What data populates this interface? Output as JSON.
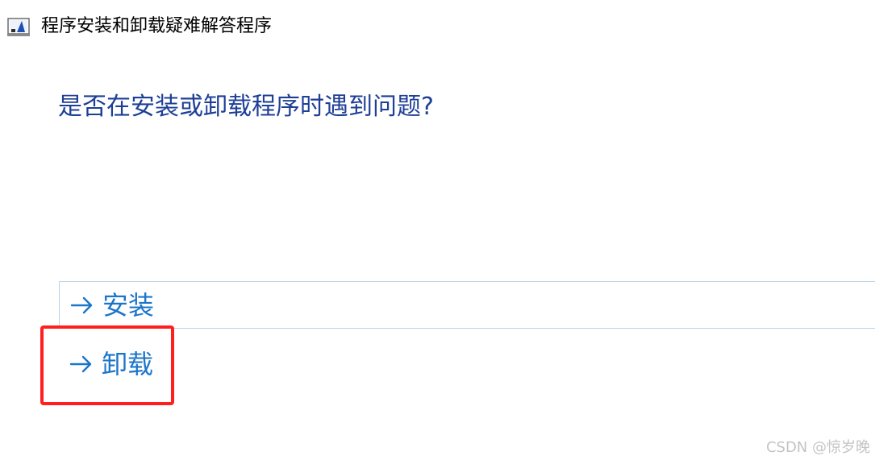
{
  "window": {
    "title": "程序安装和卸载疑难解答程序",
    "icon": "troubleshooter-app-icon"
  },
  "main": {
    "question": "是否在安装或卸载程序时遇到问题?",
    "options": [
      {
        "label": "安装",
        "icon": "arrow-right-icon"
      },
      {
        "label": "卸载",
        "icon": "arrow-right-icon"
      }
    ]
  },
  "annotation": {
    "highlight_color": "#ff1f1f"
  },
  "watermark": {
    "text": "CSDN @惊岁晚"
  },
  "colors": {
    "question": "#1e3f96",
    "link": "#1b75c9",
    "option_border": "#b9d3e8"
  }
}
